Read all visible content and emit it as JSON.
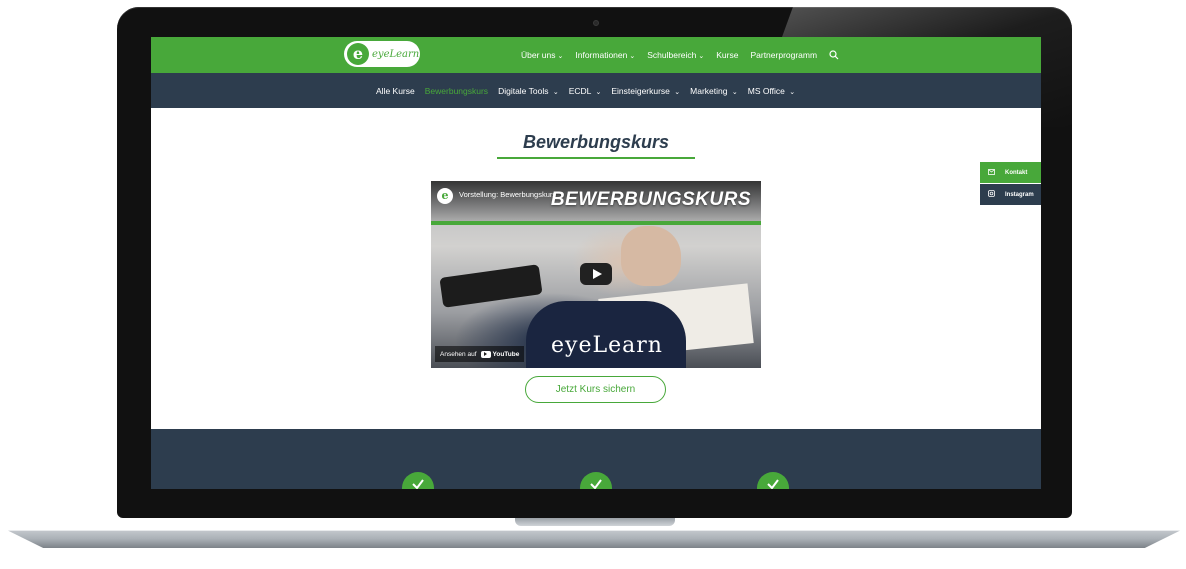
{
  "brand": {
    "logo_letter": "e",
    "logo_text": "eyeLearn"
  },
  "topnav": {
    "items": [
      "Über uns",
      "Informationen",
      "Schulbereich",
      "Kurse",
      "Partnerprogramm"
    ],
    "dropdown": [
      true,
      true,
      true,
      false,
      false
    ],
    "chevron": "⌄",
    "search_icon": "search-icon"
  },
  "subnav": {
    "items": [
      "Alle Kurse",
      "Bewerbungskurs",
      "Digitale Tools",
      "ECDL",
      "Einsteigerkurse",
      "Marketing",
      "MS Office"
    ],
    "active_index": 1,
    "chevron": "⌄"
  },
  "page": {
    "title": "Bewerbungskurs"
  },
  "side_buttons": {
    "kontakt": "Kontakt",
    "instagram": "Instagram"
  },
  "video": {
    "caption": "Vorstellung: Bewerbungskurs",
    "overlay_title": "BEWERBUNGSKURS",
    "watch_on": "Ansehen auf",
    "youtube": "YouTube",
    "brand": "eyeLearn",
    "avatar_letter": "e"
  },
  "cta": {
    "label": "Jetzt Kurs sichern"
  },
  "colors": {
    "green": "#48a83a",
    "navy": "#2d3d4e"
  }
}
